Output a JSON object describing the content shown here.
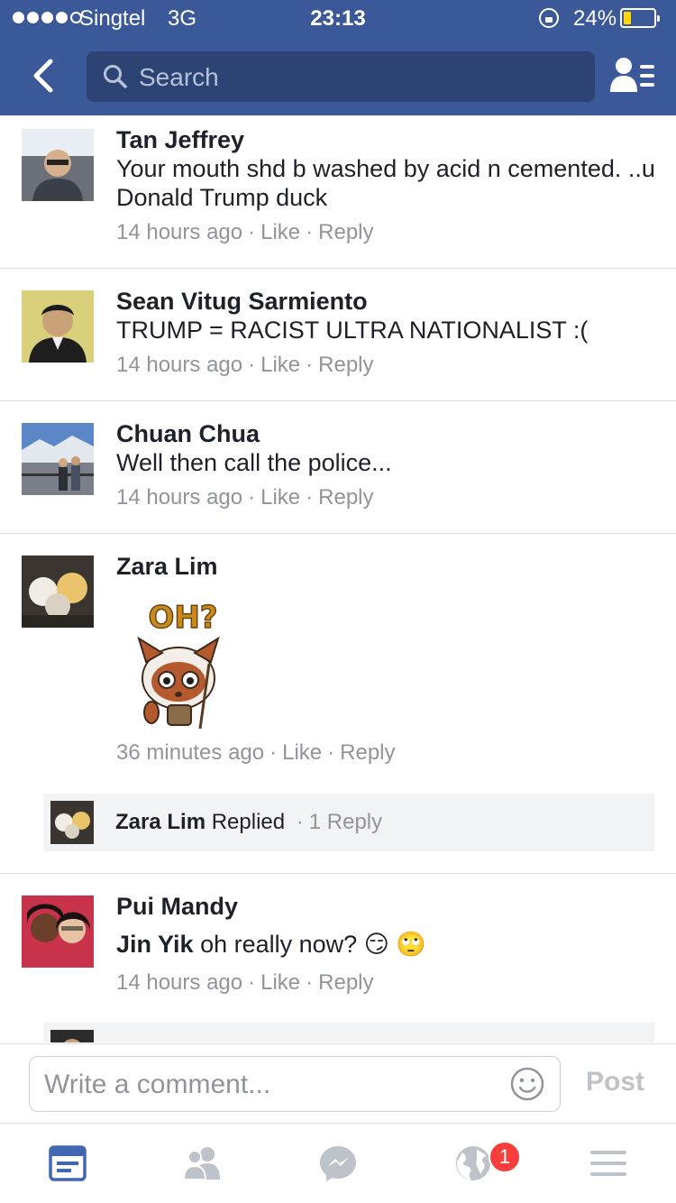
{
  "status_bar": {
    "carrier": "Singtel",
    "network": "3G",
    "time": "23:13",
    "battery": "24%",
    "battery_level": 0.24,
    "signal_bars_filled": 4
  },
  "header": {
    "search_placeholder": "Search"
  },
  "comments": [
    {
      "author": "Tan Jeffrey",
      "text": "Your mouth shd b washed by acid n cemented. ..u Donald Trump duck",
      "time": "14 hours ago",
      "like": "Like",
      "reply": "Reply"
    },
    {
      "author": "Sean Vitug Sarmiento",
      "text": "TRUMP = RACIST ULTRA NATIONALIST :(",
      "time": "14 hours ago",
      "like": "Like",
      "reply": "Reply"
    },
    {
      "author": "Chuan Chua",
      "text": "Well then call the police...",
      "time": "14 hours ago",
      "like": "Like",
      "reply": "Reply"
    },
    {
      "author": "Zara Lim",
      "sticker_text": "OH?",
      "time": "36 minutes ago",
      "like": "Like",
      "reply": "Reply",
      "replies": {
        "name": "Zara Lim",
        "verb": "Replied",
        "count": "1 Reply"
      }
    },
    {
      "author": "Pui Mandy",
      "mention": "Jin Yik",
      "text": "oh really now?",
      "emoji": "😏 🙄",
      "time": "14 hours ago",
      "like": "Like",
      "reply": "Reply"
    }
  ],
  "composer": {
    "placeholder": "Write a comment...",
    "post_label": "Post"
  },
  "tabbar": {
    "notification_count": "1",
    "colors": {
      "active": "#4267b2",
      "inactive": "#bec3c9"
    }
  },
  "colors": {
    "brand_blue": "#3b5998",
    "search_bg": "#2d4373",
    "meta_gray": "#90949c",
    "badge_red": "#fa3e3e"
  }
}
